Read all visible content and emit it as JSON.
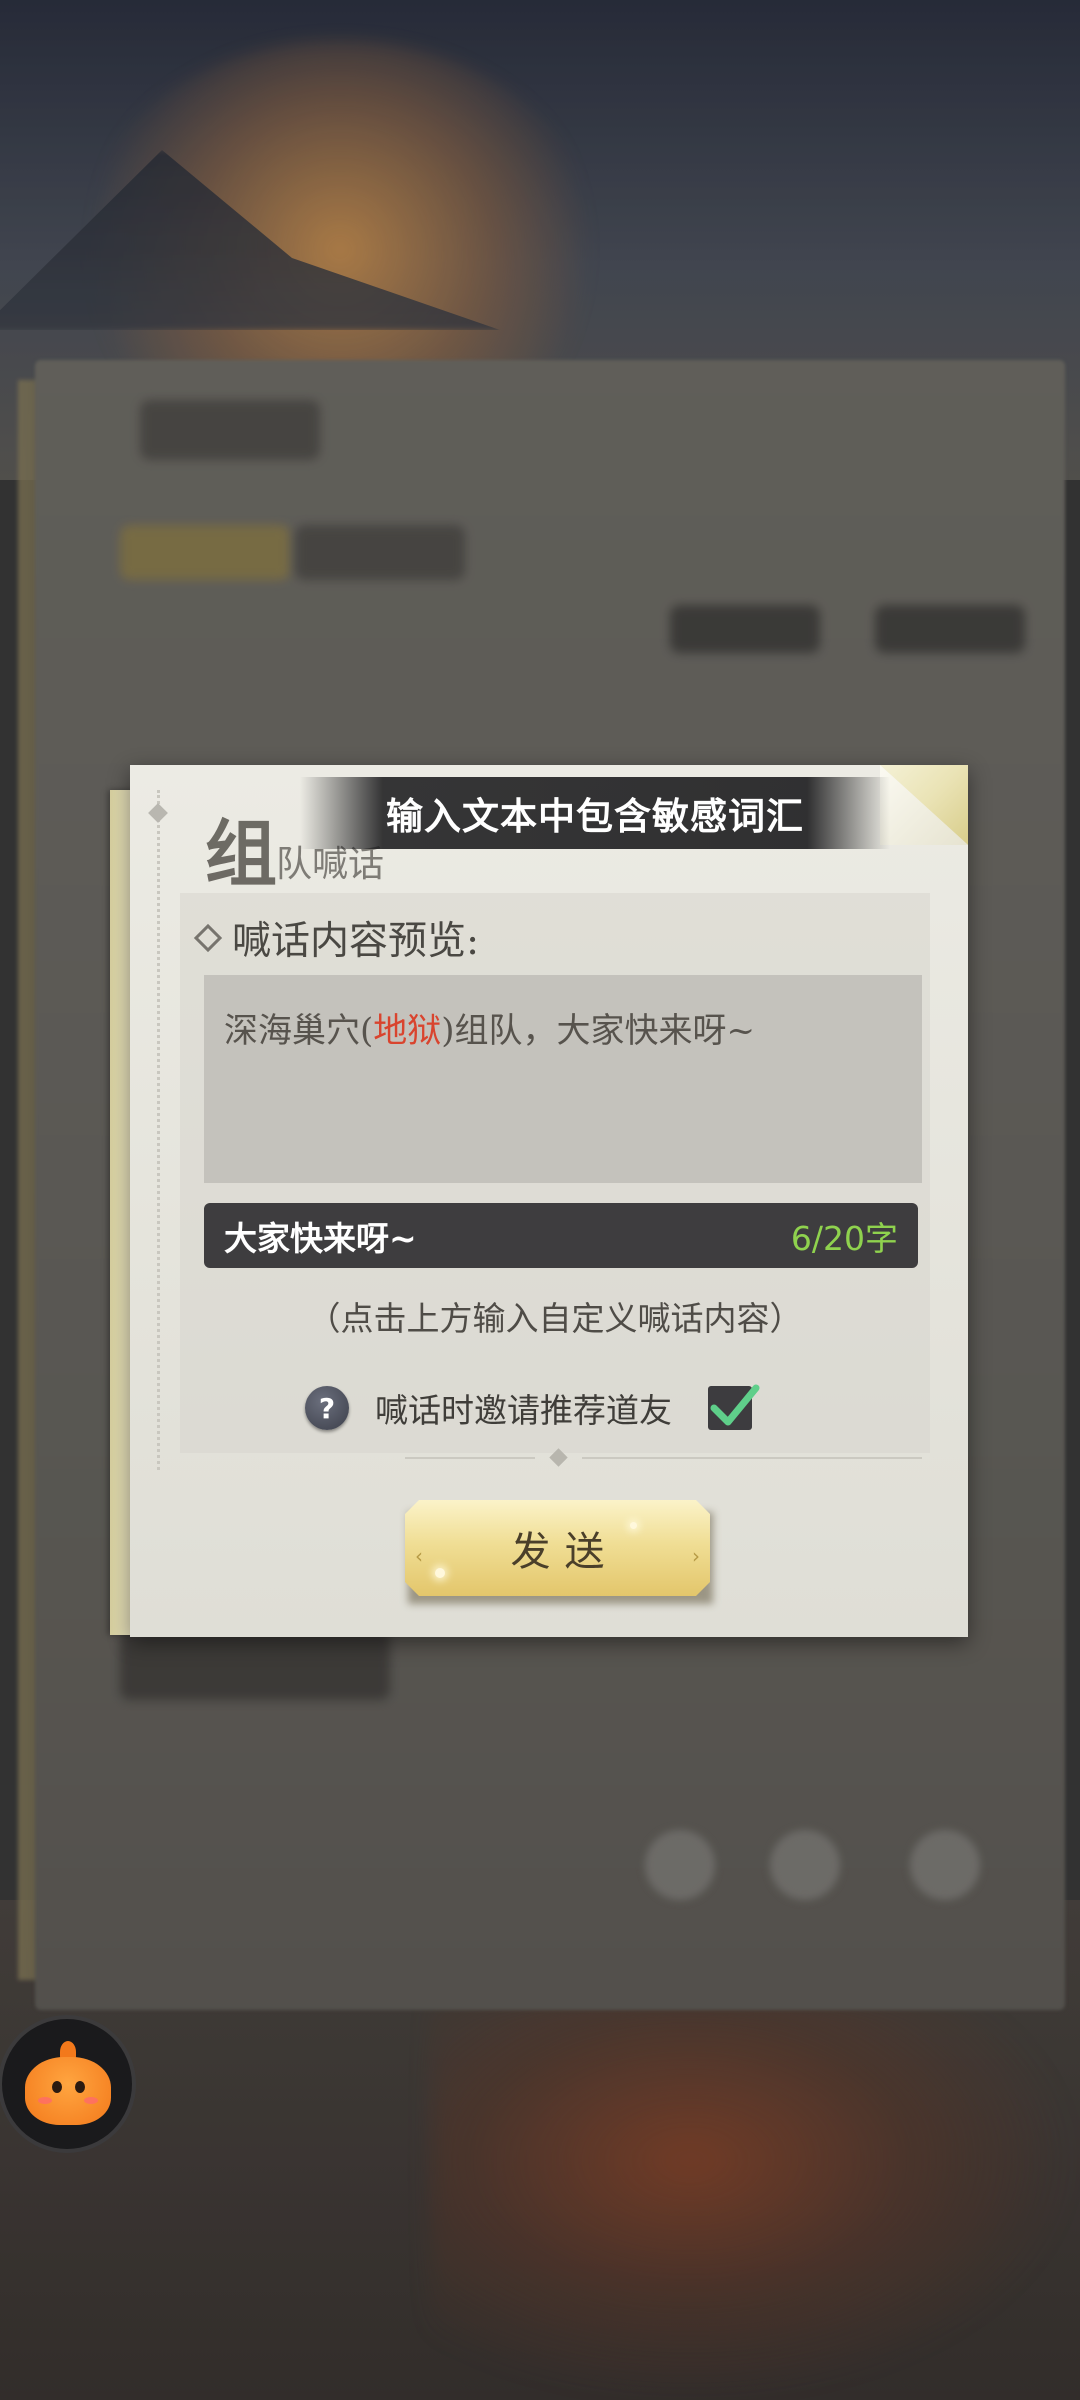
{
  "alert": {
    "text": "输入文本中包含敏感词汇"
  },
  "dialog": {
    "title_big": "组",
    "title_small": "队喊话",
    "section_label": "喊话内容预览:",
    "preview": {
      "before": "深海巢穴(",
      "sensitive": "地狱",
      "after": ")组队，大家快来呀~"
    },
    "input": {
      "value": "大家快来呀~",
      "counter": "6/20字"
    },
    "hint": "（点击上方输入自定义喊话内容）",
    "invite": {
      "label": "喊话时邀请推荐道友",
      "checked": true
    },
    "send_label": "发送"
  },
  "colors": {
    "sensitive_word": "#d9442e",
    "counter": "#8fd24e",
    "check": "#5fcf8a",
    "send_button": "#f0de95"
  },
  "icons": {
    "help": "question-mark-icon",
    "check": "checkmark-icon",
    "assistant": "orange-mascot-icon"
  }
}
